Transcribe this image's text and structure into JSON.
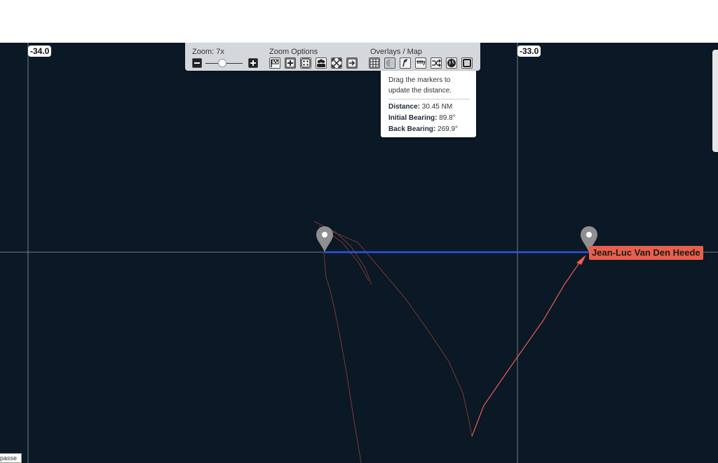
{
  "map": {
    "lon_labels": [
      "-34.0",
      "-33.0"
    ],
    "track_color": "#7a3a32",
    "route_color": "#e8604c",
    "distance_line_color": "#2a55e6"
  },
  "toolbar": {
    "zoom_label": "Zoom: 7x",
    "zoom_options_label": "Zoom Options",
    "overlays_label": "Overlays / Map"
  },
  "distance_popup": {
    "hint": "Drag the markers to update the distance.",
    "distance_label": "Distance:",
    "distance_value": "30.45 NM",
    "initial_bearing_label": "Initial Bearing:",
    "initial_bearing_value": "89.8°",
    "back_bearing_label": "Back Bearing:",
    "back_bearing_value": "269.9°"
  },
  "boat": {
    "name": "Jean-Luc Van Den Heede"
  },
  "corner_tab": {
    "text": "passe"
  },
  "icons": [
    "zoom-out-icon",
    "zoom-in-icon",
    "flag-icon",
    "plus-box-icon",
    "dice-icon",
    "group-icon",
    "fit-icon",
    "exit-icon",
    "grid-icon",
    "night-icon",
    "wind-icon",
    "course-icon",
    "shuffle-icon",
    "globe-icon",
    "map-icon",
    "marker-pin-icon"
  ]
}
